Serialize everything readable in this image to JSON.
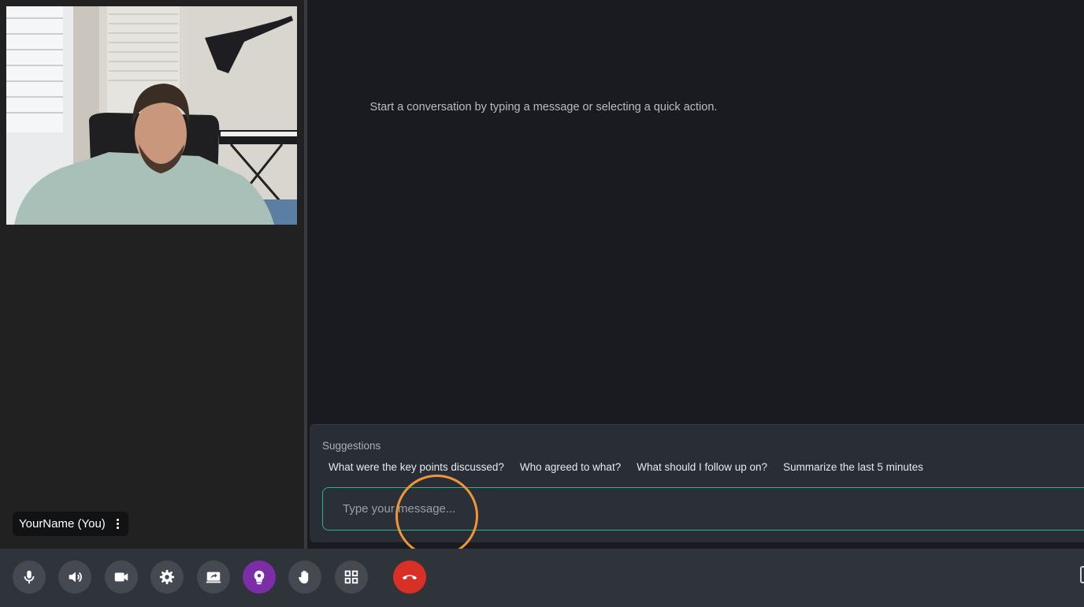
{
  "self_view": {
    "name_label": "YourName (You)"
  },
  "chat": {
    "empty_state": "Start a conversation by typing a message or selecting a quick action.",
    "suggestions_label": "Suggestions",
    "suggestions": [
      "What were the key points discussed?",
      "Who agreed to what?",
      "What should I follow up on?",
      "Summarize the last 5 minutes"
    ],
    "input": {
      "placeholder": "Type your message...",
      "value": ""
    }
  },
  "toolbar": {
    "buttons": [
      {
        "icon": "microphone-icon"
      },
      {
        "icon": "speaker-icon"
      },
      {
        "icon": "camera-icon"
      },
      {
        "icon": "gear-icon"
      },
      {
        "icon": "screen-share-icon"
      },
      {
        "icon": "ai-assistant-icon",
        "active": true
      },
      {
        "icon": "raise-hand-icon"
      },
      {
        "icon": "grid-layout-icon"
      },
      {
        "icon": "hang-up-icon"
      }
    ]
  },
  "colors": {
    "accent_green": "#2fb384",
    "assistant_purple": "#7b2ea6",
    "hangup_red": "#d93025",
    "cursor_ring": "#f0963a"
  }
}
